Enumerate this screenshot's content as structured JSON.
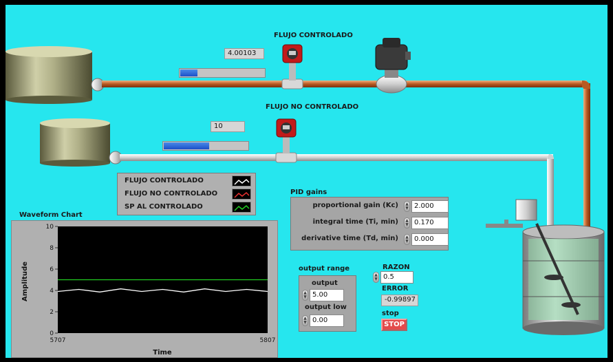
{
  "flows": {
    "controlled": {
      "title": "FLUJO CONTROLADO",
      "value": "4.00103",
      "level": 0.22
    },
    "uncontrolled": {
      "title": "FLUJO NO CONTROLADO",
      "value": "10",
      "level": 0.55
    }
  },
  "legend": {
    "items": [
      {
        "label": "FLUJO CONTROLADO",
        "color": "#ffffff"
      },
      {
        "label": "FLUJO NO CONTROLADO",
        "color": "#e83030"
      },
      {
        "label": "SP AL CONTROLADO",
        "color": "#22cc22"
      }
    ]
  },
  "pid": {
    "title": "PID gains",
    "kc_label": "proportional gain (Kc)",
    "kc": "2.000",
    "ti_label": "integral time (Ti, min)",
    "ti": "0.170",
    "td_label": "derivative time (Td, min)",
    "td": "0.000"
  },
  "output_range": {
    "title": "output range",
    "high_label": "output",
    "high": "5.00",
    "low_label": "output low",
    "low": "0.00"
  },
  "razon": {
    "label": "RAZON",
    "value": "0.5"
  },
  "error": {
    "label": "ERROR",
    "value": "-0.99897"
  },
  "stop": {
    "label": "stop",
    "button": "STOP"
  },
  "chart_data": {
    "type": "line",
    "title": "Waveform Chart",
    "xlabel": "Time",
    "ylabel": "Amplitude",
    "xlim": [
      5707,
      5807
    ],
    "ylim": [
      0,
      10
    ],
    "x_ticks": [
      "5707",
      "5807"
    ],
    "y_ticks": [
      "0",
      "2",
      "4",
      "6",
      "8",
      "10"
    ],
    "series": [
      {
        "name": "SP AL CONTROLADO",
        "color": "#22cc22",
        "values": [
          5,
          5,
          5,
          5,
          5,
          5,
          5,
          5,
          5,
          5,
          5
        ]
      },
      {
        "name": "FLUJO CONTROLADO",
        "color": "#ffffff",
        "values": [
          3.9,
          4.1,
          3.85,
          4.15,
          3.9,
          4.1,
          3.85,
          4.15,
          3.9,
          4.1,
          3.9
        ]
      }
    ]
  }
}
